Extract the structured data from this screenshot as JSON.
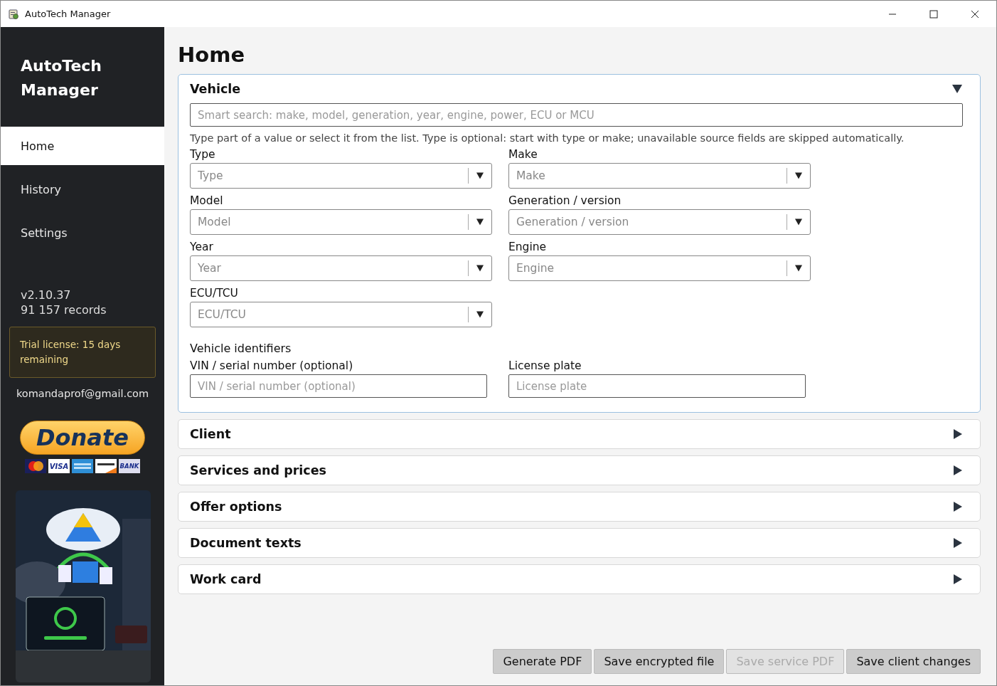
{
  "window": {
    "title": "AutoTech Manager"
  },
  "sidebar": {
    "app_name": "AutoTech Manager",
    "items": [
      {
        "label": "Home",
        "selected": true
      },
      {
        "label": "History",
        "selected": false
      },
      {
        "label": "Settings",
        "selected": false
      }
    ],
    "version": "v2.10.37",
    "records": "91 157 records",
    "license": "Trial license: 15 days remaining",
    "email": "komandaprof@gmail.com",
    "donate": {
      "label": "Donate",
      "cards": [
        "VISA",
        "BANK"
      ]
    }
  },
  "page_title": "Home",
  "sections": [
    {
      "title": "Vehicle",
      "expanded": true
    },
    {
      "title": "Client",
      "expanded": false
    },
    {
      "title": "Services and prices",
      "expanded": false
    },
    {
      "title": "Offer options",
      "expanded": false
    },
    {
      "title": "Document texts",
      "expanded": false
    },
    {
      "title": "Work card",
      "expanded": false
    }
  ],
  "vehicle": {
    "search_placeholder": "Smart search: make, model, generation, year, engine, power, ECU or MCU",
    "hint": "Type part of a value or select it from the list. Type is optional: start with type or make; unavailable source fields are skipped automatically.",
    "fields": [
      {
        "label": "Type",
        "placeholder": "Type"
      },
      {
        "label": "Make",
        "placeholder": "Make"
      },
      {
        "label": "Model",
        "placeholder": "Model"
      },
      {
        "label": "Generation / version",
        "placeholder": "Generation / version"
      },
      {
        "label": "Year",
        "placeholder": "Year"
      },
      {
        "label": "Engine",
        "placeholder": "Engine"
      },
      {
        "label": "ECU/TCU",
        "placeholder": "ECU/TCU"
      }
    ],
    "identifiers_title": "Vehicle identifiers",
    "identifiers": [
      {
        "label": "VIN / serial number (optional)",
        "placeholder": "VIN / serial number (optional)"
      },
      {
        "label": "License plate",
        "placeholder": "License plate"
      }
    ]
  },
  "buttons": [
    {
      "label": "Generate PDF",
      "disabled": false
    },
    {
      "label": "Save encrypted file",
      "disabled": false
    },
    {
      "label": "Save service PDF",
      "disabled": true
    },
    {
      "label": "Save client changes",
      "disabled": false
    }
  ]
}
